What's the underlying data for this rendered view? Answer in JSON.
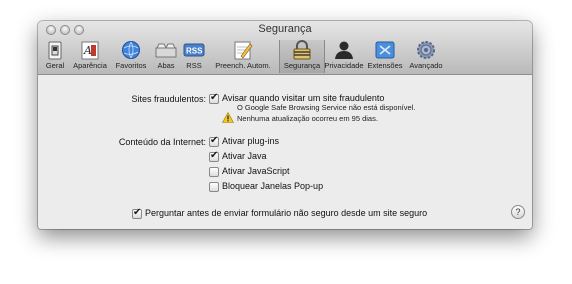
{
  "window": {
    "title": "Segurança"
  },
  "toolbar": {
    "items": [
      {
        "label": "Geral",
        "icon": "switch-icon"
      },
      {
        "label": "Aparência",
        "icon": "text-style-icon"
      },
      {
        "label": "Favoritos",
        "icon": "globe-icon"
      },
      {
        "label": "Abas",
        "icon": "tabs-icon"
      },
      {
        "label": "RSS",
        "icon": "rss-icon"
      },
      {
        "label": "Preench. Autom.",
        "icon": "pencil-icon"
      },
      {
        "label": "Segurança",
        "icon": "lock-icon",
        "selected": true
      },
      {
        "label": "Privacidade",
        "icon": "person-icon"
      },
      {
        "label": "Extensões",
        "icon": "puzzle-icon"
      },
      {
        "label": "Avançado",
        "icon": "gear-icon"
      }
    ]
  },
  "fraud": {
    "label": "Sites fraudulentos:",
    "checkbox_label": "Avisar quando visitar um site fraudulento",
    "checked": true,
    "warning_line1": "O Google Safe Browsing Service não está disponível.",
    "warning_line2": "Nenhuma atualização ocorreu em 95 dias."
  },
  "content": {
    "label": "Conteúdo da Internet:",
    "options": [
      {
        "label": "Ativar plug-ins",
        "checked": true
      },
      {
        "label": "Ativar Java",
        "checked": true
      },
      {
        "label": "Ativar JavaScript",
        "checked": false
      },
      {
        "label": "Bloquear Janelas Pop-up",
        "checked": false
      }
    ]
  },
  "insecure_form": {
    "label": "Perguntar antes de enviar formulário não seguro desde um site seguro",
    "checked": true
  },
  "help": {
    "glyph": "?"
  }
}
